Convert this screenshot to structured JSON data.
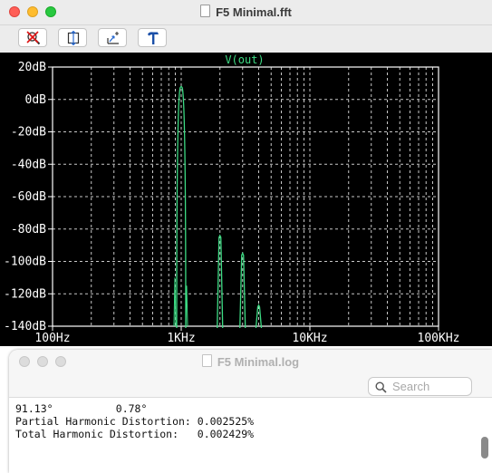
{
  "fft_window": {
    "title": "F5 Minimal.fft",
    "toolbar": [
      {
        "name": "zoom-cancel",
        "icon": "magnifier-cross-icon"
      },
      {
        "name": "zoom-extents",
        "icon": "zoom-extents-icon"
      },
      {
        "name": "zoom-back",
        "icon": "zoom-back-icon"
      },
      {
        "name": "hammer-tool",
        "icon": "hammer-icon"
      }
    ]
  },
  "log_window": {
    "title": "F5 Minimal.log",
    "search_placeholder": "Search",
    "lines": [
      "91.13°          0.78°",
      "Partial Harmonic Distortion: 0.002525%",
      "Total Harmonic Distortion:   0.002429%"
    ]
  },
  "colors": {
    "plot_background": "#000000",
    "trace": "#3ddc84",
    "grid": "#c8c8c8",
    "axis_text": "#ffffff"
  },
  "chart_data": {
    "type": "line",
    "title": "V(out)",
    "x_scale": "log",
    "xlim": [
      100,
      100000
    ],
    "ylim": [
      -140,
      20
    ],
    "x_ticks": [
      {
        "value": 100,
        "label": "100Hz"
      },
      {
        "value": 1000,
        "label": "1KHz"
      },
      {
        "value": 10000,
        "label": "10KHz"
      },
      {
        "value": 100000,
        "label": "100KHz"
      }
    ],
    "y_ticks": [
      {
        "value": 20,
        "label": "20dB"
      },
      {
        "value": 0,
        "label": "0dB"
      },
      {
        "value": -20,
        "label": "-20dB"
      },
      {
        "value": -40,
        "label": "-40dB"
      },
      {
        "value": -60,
        "label": "-60dB"
      },
      {
        "value": -80,
        "label": "-80dB"
      },
      {
        "value": -100,
        "label": "-100dB"
      },
      {
        "value": -120,
        "label": "-120dB"
      },
      {
        "value": -140,
        "label": "-140dB"
      }
    ],
    "grid": true,
    "series": [
      {
        "name": "V(out)",
        "peaks": [
          {
            "frequency": 1000,
            "level_db": 8
          },
          {
            "frequency": 2000,
            "level_db": -84
          },
          {
            "frequency": 3000,
            "level_db": -95
          },
          {
            "frequency": 4000,
            "level_db": -127
          }
        ],
        "noise_floor_db": -140
      }
    ]
  }
}
